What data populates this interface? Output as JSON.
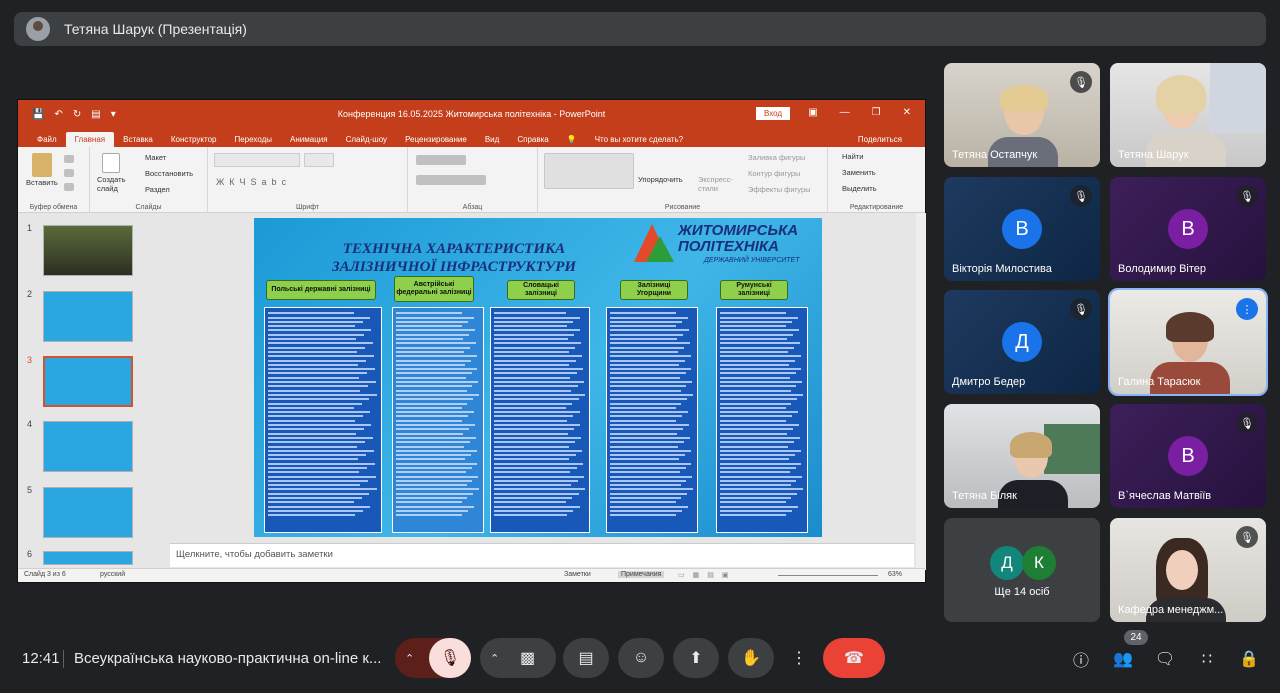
{
  "presenter_bar": {
    "title": "Тетяна Шарук (Презентація)"
  },
  "powerpoint": {
    "window_title": "Конференция 16.05.2025 Житомирська політехніка - PowerPoint",
    "signin": "Вход",
    "tabs": [
      "Файл",
      "Главная",
      "Вставка",
      "Конструктор",
      "Переходы",
      "Анимация",
      "Слайд-шоу",
      "Рецензирование",
      "Вид",
      "Справка"
    ],
    "tell_me": "Что вы хотите сделать?",
    "share": "Поделиться",
    "ribbon": {
      "paste": "Вставить",
      "create_slide": "Создать слайд",
      "layout": "Макет",
      "reset": "Восстановить",
      "section": "Раздел",
      "arrange": "Упорядочить",
      "quick_styles": "Экспресс-стили",
      "fill": "Заливка фигуры",
      "outline": "Контур фигуры",
      "effects": "Эффекты фигуры",
      "find": "Найти",
      "replace": "Заменить",
      "select": "Выделить",
      "groups": [
        "Буфер обмена",
        "Слайды",
        "Шрифт",
        "Абзац",
        "Рисование",
        "Редактирование"
      ]
    },
    "slide_numbers": [
      "1",
      "2",
      "3",
      "4",
      "5",
      "6"
    ],
    "slide": {
      "title_line1": "ТЕХНІЧНА ХАРАКТЕРИСТИКА",
      "title_line2": "ЗАЛІЗНИЧНОЇ ІНФРАСТРУКТУРИ",
      "logo_line1": "ЖИТОМИРСЬКА",
      "logo_line2": "ПОЛІТЕХНІКА",
      "logo_line3": "ДЕРЖАВНИЙ УНІВЕРСИТЕТ",
      "columns": [
        "Польські державні залізниці",
        "Австрійські федеральні залізниці",
        "Словацькі залізниці",
        "Залізниці Угорщини",
        "Румунські залізниці"
      ]
    },
    "notes_placeholder": "Щелкните, чтобы добавить заметки",
    "status": {
      "slide_info": "Слайд 3 из 6",
      "language": "русский",
      "notes": "Заметки",
      "comments": "Примечания",
      "zoom": "63%"
    }
  },
  "participants": [
    {
      "name": "Тетяна Остапчук"
    },
    {
      "name": "Тетяна Шарук"
    },
    {
      "name": "Вікторія Милостива",
      "initial": "В",
      "color": "#1a73e8"
    },
    {
      "name": "Володимир Вітер",
      "initial": "В",
      "color": "#7b1fa2"
    },
    {
      "name": "Дмитро Бедер",
      "initial": "Д",
      "color": "#1a73e8"
    },
    {
      "name": "Галина Тарасюк"
    },
    {
      "name": "Тетяна Біляк"
    },
    {
      "name": "В`ячеслав Матвіїв",
      "initial": "В",
      "color": "#7b1fa2"
    },
    {
      "name": "Ще 14 осіб",
      "initials": [
        "Д",
        "К"
      ]
    },
    {
      "name": "Кафедра менеджм..."
    }
  ],
  "bottom_bar": {
    "time": "12:41",
    "meeting_title": "Всеукраїнська науково-практична on-line к...",
    "participant_count": "24"
  },
  "icons": [
    "microphone-off-icon",
    "camera-icon",
    "captions-icon",
    "emoji-icon",
    "present-icon",
    "raise-hand-icon",
    "more-options-icon",
    "end-call-icon",
    "info-icon",
    "people-icon",
    "chat-icon",
    "activities-icon",
    "host-controls-icon"
  ]
}
